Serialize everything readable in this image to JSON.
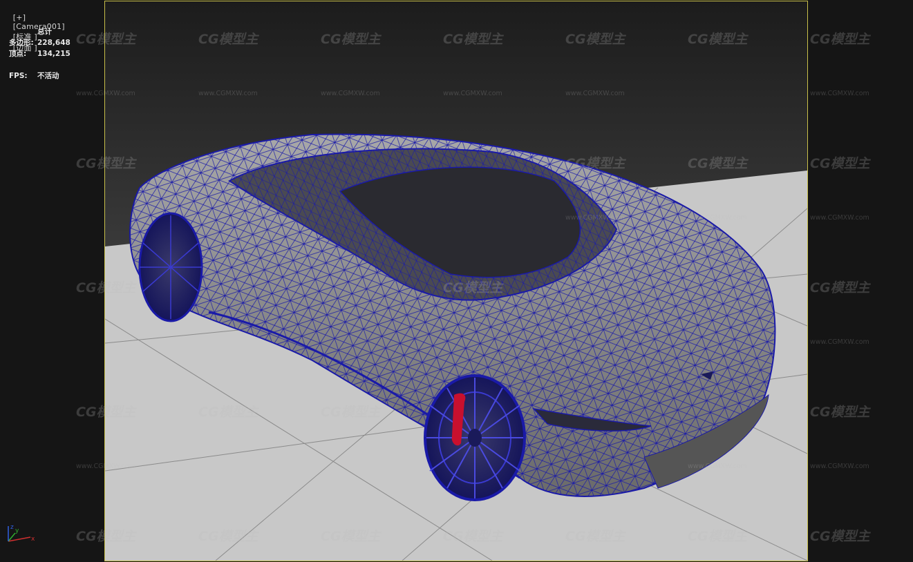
{
  "viewport": {
    "label": "[+]  [Camera001]  [标准 ]  [边面 ]",
    "label_parts": [
      "[+]",
      "[Camera001]",
      "[标准 ]",
      "[边面 ]"
    ]
  },
  "stats": {
    "header": "总计",
    "polygons_label": "多边形:",
    "polygons_value": "228,648",
    "vertices_label": "顶点:",
    "vertices_value": "134,215",
    "fps_label": "FPS:",
    "fps_value": "不活动"
  },
  "watermark": {
    "logo_text": "CG模型主",
    "url_text": "www.CGMXW.com"
  },
  "axis_gizmo": {
    "x_label": "x",
    "y_label": "y",
    "z_label": "z"
  },
  "colors": {
    "frame_border": "#c9c04a",
    "wireframe": "#1a1aa8",
    "car_surface": "#9a9a9a",
    "ground": "#c8c8c8",
    "brake_caliper": "#c8102e",
    "axis_x": "#d03030",
    "axis_y": "#30b030",
    "axis_z": "#3060e0"
  },
  "icons": [
    "axis-gizmo-icon",
    "tesla-logo-icon"
  ]
}
